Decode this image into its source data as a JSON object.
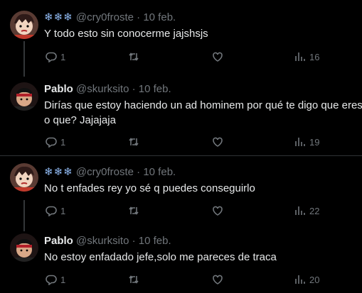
{
  "tweets": [
    {
      "name_prefix": "❄❄❄",
      "name": "",
      "handle": "@cry0froste",
      "date": "10 feb.",
      "text": "Y todo esto sin conocerme jajshsjs",
      "replies": "1",
      "retweets": "",
      "likes": "",
      "views": "16"
    },
    {
      "name_prefix": "",
      "name": "Pablo",
      "handle": "@skurksito",
      "date": "10 feb.",
      "text": "Dirías que estoy haciendo un ad hominem por qué te digo que eres\no que? Jajajaja",
      "replies": "1",
      "retweets": "",
      "likes": "",
      "views": "19"
    },
    {
      "name_prefix": "❄❄❄",
      "name": "",
      "handle": "@cry0froste",
      "date": "10 feb.",
      "text": "No t enfades rey yo sé q puedes conseguirlo",
      "replies": "1",
      "retweets": "",
      "likes": "",
      "views": "22"
    },
    {
      "name_prefix": "",
      "name": "Pablo",
      "handle": "@skurksito",
      "date": "10 feb.",
      "text": "No estoy enfadado jefe,solo me pareces de traca",
      "replies": "1",
      "retweets": "",
      "likes": "",
      "views": "20"
    }
  ],
  "separator": "·",
  "icons": {
    "reply": "reply-icon",
    "retweet": "retweet-icon",
    "like": "heart-icon",
    "views": "views-icon"
  },
  "colors": {
    "background": "#000000",
    "text": "#e7e9ea",
    "muted": "#71767b",
    "divider": "#2f3336"
  }
}
